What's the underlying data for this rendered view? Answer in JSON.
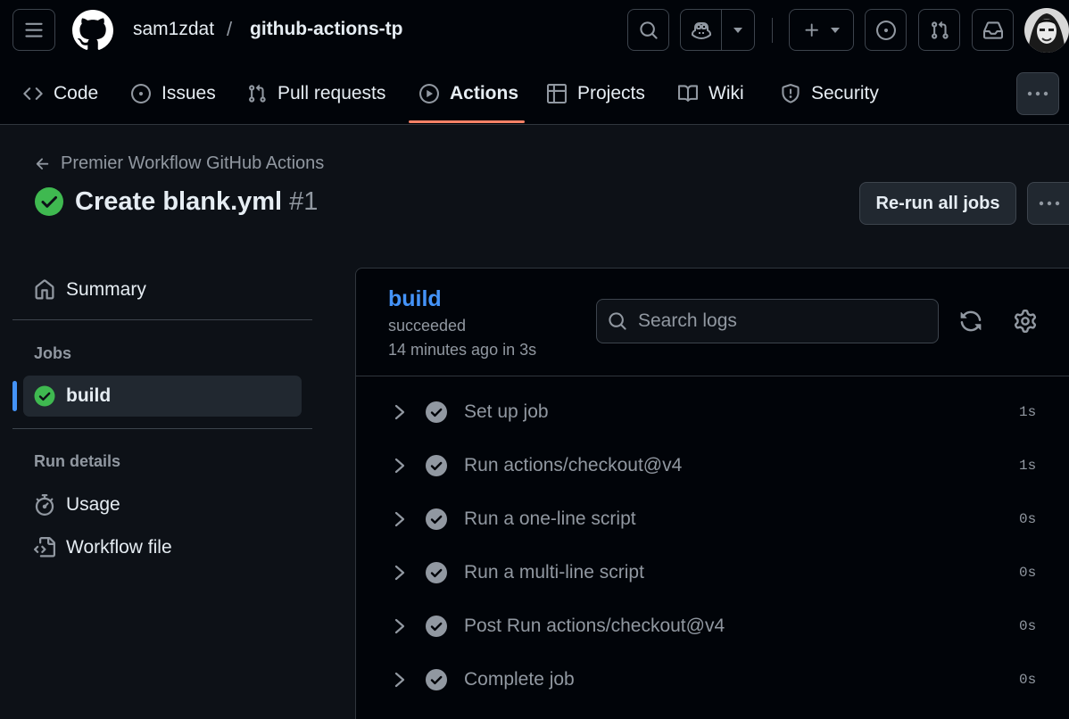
{
  "header": {
    "owner": "sam1zdat",
    "separator": "/",
    "repo": "github-actions-tp"
  },
  "tabs": [
    {
      "label": "Code",
      "icon": "code-icon"
    },
    {
      "label": "Issues",
      "icon": "issue-opened-icon"
    },
    {
      "label": "Pull requests",
      "icon": "git-pull-request-icon"
    },
    {
      "label": "Actions",
      "icon": "play-icon",
      "active": true
    },
    {
      "label": "Projects",
      "icon": "table-icon"
    },
    {
      "label": "Wiki",
      "icon": "book-icon"
    },
    {
      "label": "Security",
      "icon": "shield-icon"
    }
  ],
  "run": {
    "back_label": "Premier Workflow GitHub Actions",
    "title": "Create blank.yml",
    "number": "#1",
    "rerun_label": "Re-run all jobs",
    "status_color": "#3fb950"
  },
  "sidebar": {
    "summary_label": "Summary",
    "jobs_heading": "Jobs",
    "job_label": "build",
    "run_details_heading": "Run details",
    "usage_label": "Usage",
    "workflow_file_label": "Workflow file"
  },
  "job": {
    "name": "build",
    "status": "succeeded",
    "time": "14 minutes ago in 3s",
    "search_placeholder": "Search logs",
    "steps": [
      {
        "name": "Set up job",
        "duration": "1s"
      },
      {
        "name": "Run actions/checkout@v4",
        "duration": "1s"
      },
      {
        "name": "Run a one-line script",
        "duration": "0s"
      },
      {
        "name": "Run a multi-line script",
        "duration": "0s"
      },
      {
        "name": "Post Run actions/checkout@v4",
        "duration": "0s"
      },
      {
        "name": "Complete job",
        "duration": "0s"
      }
    ]
  },
  "colors": {
    "accent_link": "#4493f8",
    "success": "#3fb950",
    "active_tab_underline": "#f78166"
  }
}
